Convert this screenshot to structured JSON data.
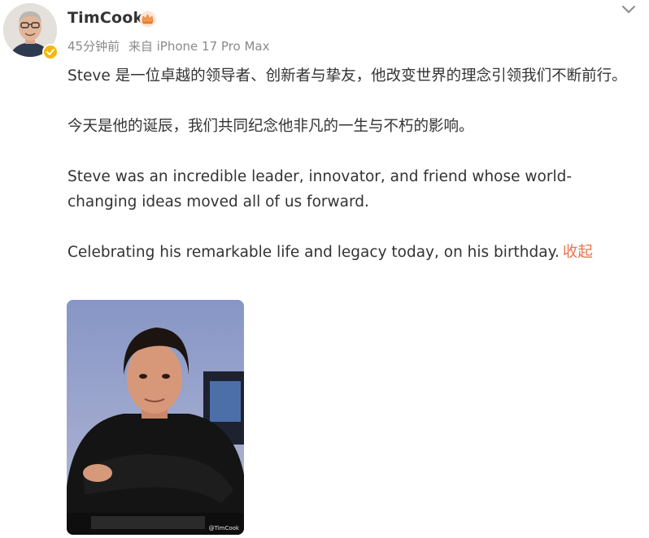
{
  "user": {
    "name": "TimCook",
    "avatar_icon": "avatar-icon",
    "badge_icon": "crown-icon",
    "verified_icon": "verified-icon",
    "verified_color": "#f5b800"
  },
  "meta": {
    "time": "45分钟前",
    "source": "来自 iPhone 17 Pro Max"
  },
  "post": {
    "paragraphs": [
      "Steve 是一位卓越的领导者、创新者与挚友，他改变世界的理念引领我们不断前行。",
      "今天是他的诞辰，我们共同纪念他非凡的一生与不朽的影响。",
      "Steve was an incredible leader, innovator, and friend whose world-changing ideas moved all of us forward.",
      "Celebrating his remarkable life and legacy today, on his birthday."
    ],
    "collapse_label": "收起",
    "link_color": "#eb7350"
  },
  "image": {
    "watermark": "@TimCook"
  },
  "controls": {
    "menu_icon": "chevron-down-icon"
  }
}
